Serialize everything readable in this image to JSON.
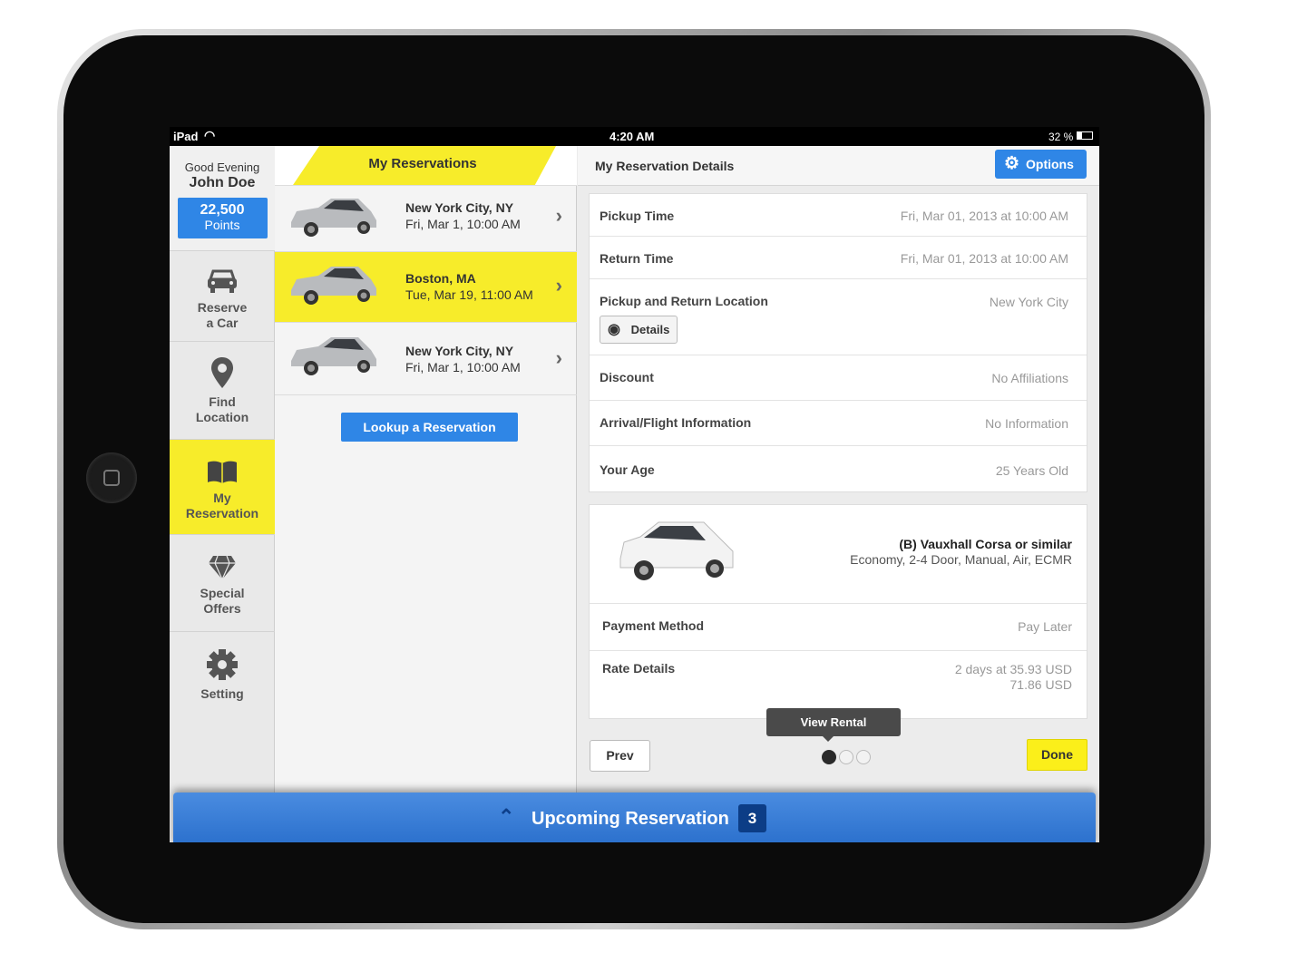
{
  "status_bar": {
    "device": "iPad",
    "time": "4:20 AM",
    "battery": "32 %"
  },
  "sidebar": {
    "greeting": "Good Evening",
    "user_name": "John Doe",
    "points_value": "22,500",
    "points_label": "Points",
    "items": [
      {
        "label_1": "Reserve",
        "label_2": "a Car",
        "icon": "car-icon"
      },
      {
        "label_1": "Find",
        "label_2": "Location",
        "icon": "map-pin-icon"
      },
      {
        "label_1": "My",
        "label_2": "Reservation",
        "icon": "book-icon",
        "active": true
      },
      {
        "label_1": "Special",
        "label_2": "Offers",
        "icon": "diamond-icon"
      },
      {
        "label_1": "Setting",
        "icon": "gear-icon"
      }
    ]
  },
  "reservations": {
    "title": "My Reservations",
    "items": [
      {
        "city": "New York City, NY",
        "date": "Fri, Mar 1, 10:00 AM"
      },
      {
        "city": "Boston, MA",
        "date": "Tue, Mar 19, 11:00 AM",
        "selected": true
      },
      {
        "city": "New York City, NY",
        "date": "Fri, Mar 1, 10:00 AM"
      }
    ],
    "lookup_label": "Lookup a Reservation"
  },
  "details": {
    "title": "My Reservation Details",
    "options_label": "Options",
    "rows": [
      {
        "label": "Pickup Time",
        "value": "Fri, Mar 01, 2013 at 10:00 AM"
      },
      {
        "label": "Return Time",
        "value": "Fri, Mar 01, 2013 at 10:00 AM"
      },
      {
        "label": "Pickup and Return Location",
        "value": "New York City",
        "button": "Details"
      },
      {
        "label": "Discount",
        "value": "No Affiliations"
      },
      {
        "label": "Arrival/Flight Information",
        "value": "No Information"
      },
      {
        "label": "Your Age",
        "value": "25 Years Old"
      }
    ],
    "car": {
      "name": "(B) Vauxhall Corsa or similar",
      "specs": "Economy, 2-4 Door, Manual, Air, ECMR"
    },
    "payment": {
      "label": "Payment Method",
      "value": "Pay Later"
    },
    "rate": {
      "label": "Rate Details",
      "line1": "2 days at 35.93 USD",
      "line2": "71.86 USD"
    },
    "tooltip": "View Rental",
    "prev_label": "Prev",
    "done_label": "Done",
    "page_current": 1,
    "page_total": 3
  },
  "bottom_bar": {
    "label": "Upcoming Reservation",
    "count": "3"
  },
  "colors": {
    "yellow": "#f7ec2a",
    "blue": "#2f86e6",
    "bar_blue": "#2a6fcc"
  }
}
